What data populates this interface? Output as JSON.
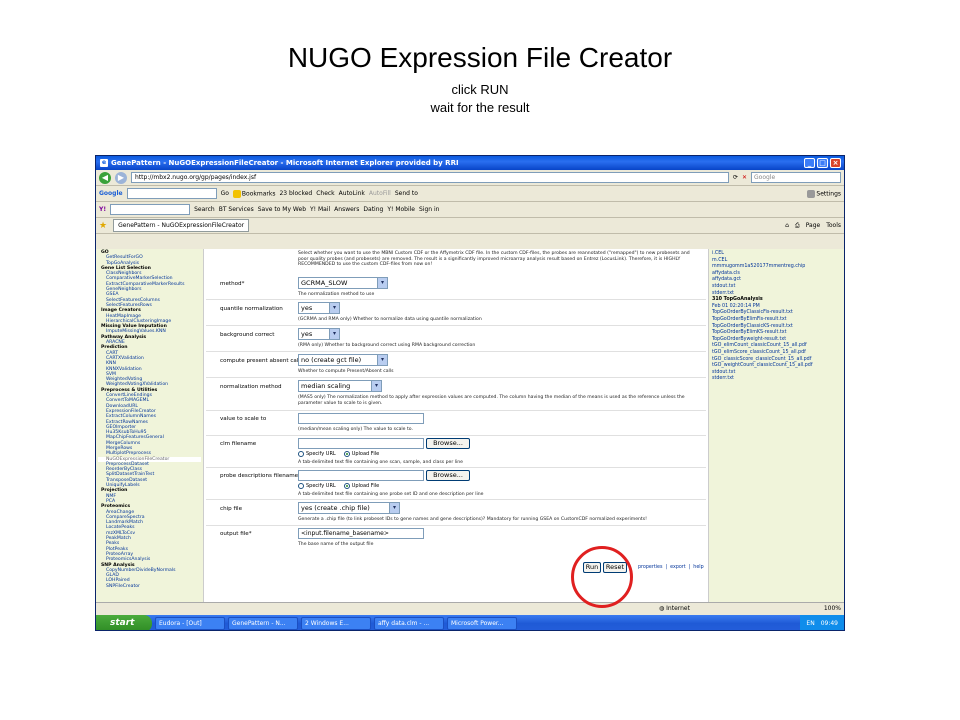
{
  "slide": {
    "title": "NUGO Expression File Creator",
    "subtitle1": "click RUN",
    "subtitle2": "wait for the result"
  },
  "browser": {
    "window_title": "GenePattern - NuGOExpressionFileCreator - Microsoft Internet Explorer provided by RRI",
    "address_label": "Address",
    "url": "http://mbx2.nugo.org/gp/pages/index.jsf",
    "search_placeholder": "Google",
    "google_bar": [
      "Google",
      "Go",
      "Bookmarks",
      "23 blocked",
      "Check",
      "AutoLink",
      "AutoFill",
      "Send to",
      "Settings"
    ],
    "yahoo_bar": [
      "Y!",
      "Search",
      "BT Services",
      "Save to My Web",
      "Y! Mail",
      "Answers",
      "Dating",
      "Y! Mobile",
      "Sign in"
    ],
    "tab_title": "GenePattern - NuGOExpressionFileCreator",
    "tab_tools": [
      "Page",
      "Tools"
    ]
  },
  "sidebar": {
    "items": [
      {
        "label": "GO",
        "type": "cat"
      },
      {
        "label": "GetResultForGO",
        "type": "item"
      },
      {
        "label": "TopGoAnalysis",
        "type": "item"
      },
      {
        "label": "Gene List Selection",
        "type": "cat"
      },
      {
        "label": "ClassNeighbors",
        "type": "item"
      },
      {
        "label": "ComparativeMarkerSelection",
        "type": "item"
      },
      {
        "label": "ExtractComparativeMarkerResults",
        "type": "item"
      },
      {
        "label": "GeneNeighbors",
        "type": "item"
      },
      {
        "label": "GSEA",
        "type": "item"
      },
      {
        "label": "SelectFeaturesColumns",
        "type": "item"
      },
      {
        "label": "SelectFeaturesRows",
        "type": "item"
      },
      {
        "label": "Image Creators",
        "type": "cat"
      },
      {
        "label": "HeatMapImage",
        "type": "item"
      },
      {
        "label": "HierarchicalClusteringImage",
        "type": "item"
      },
      {
        "label": "Missing Value Imputation",
        "type": "cat"
      },
      {
        "label": "ImputeMissingValues.KNN",
        "type": "item"
      },
      {
        "label": "Pathway Analysis",
        "type": "cat"
      },
      {
        "label": "ARACNE",
        "type": "item"
      },
      {
        "label": "Prediction",
        "type": "cat"
      },
      {
        "label": "CART",
        "type": "item"
      },
      {
        "label": "CARTXValidation",
        "type": "item"
      },
      {
        "label": "KNN",
        "type": "item"
      },
      {
        "label": "KNNXValidation",
        "type": "item"
      },
      {
        "label": "SVM",
        "type": "item"
      },
      {
        "label": "WeightedVoting",
        "type": "item"
      },
      {
        "label": "WeightedVotingXValidation",
        "type": "item"
      },
      {
        "label": "Preprocess & Utilities",
        "type": "cat"
      },
      {
        "label": "ConvertLineEndings",
        "type": "item"
      },
      {
        "label": "ConvertToMAGEML",
        "type": "item"
      },
      {
        "label": "DownloadURL",
        "type": "item"
      },
      {
        "label": "ExpressionFileCreator",
        "type": "item"
      },
      {
        "label": "ExtractColumnNames",
        "type": "item"
      },
      {
        "label": "ExtractRowNames",
        "type": "item"
      },
      {
        "label": "GEOImporter",
        "type": "item"
      },
      {
        "label": "Hu35KsubToHu95",
        "type": "item"
      },
      {
        "label": "MapChipFeaturesGeneral",
        "type": "item"
      },
      {
        "label": "MergeColumns",
        "type": "item"
      },
      {
        "label": "MergeRows",
        "type": "item"
      },
      {
        "label": "MultiplotPreprocess",
        "type": "item"
      },
      {
        "label": "NuGOExpressionFileCreator",
        "type": "sel"
      },
      {
        "label": "PreprocessDataset",
        "type": "item"
      },
      {
        "label": "ReorderByClass",
        "type": "item"
      },
      {
        "label": "SplitDatasetTrainTest",
        "type": "item"
      },
      {
        "label": "TransposeDataset",
        "type": "item"
      },
      {
        "label": "UniquifyLabels",
        "type": "item"
      },
      {
        "label": "Projection",
        "type": "cat"
      },
      {
        "label": "NMF",
        "type": "item"
      },
      {
        "label": "PCA",
        "type": "item"
      },
      {
        "label": "Proteomics",
        "type": "cat"
      },
      {
        "label": "AreaChange",
        "type": "item"
      },
      {
        "label": "CompareSpectra",
        "type": "item"
      },
      {
        "label": "LandmarkMatch",
        "type": "item"
      },
      {
        "label": "LocatePeaks",
        "type": "item"
      },
      {
        "label": "mzXMLToCsv",
        "type": "item"
      },
      {
        "label": "PeakMatch",
        "type": "item"
      },
      {
        "label": "Peaks",
        "type": "item"
      },
      {
        "label": "PlotPeaks",
        "type": "item"
      },
      {
        "label": "ProteoArray",
        "type": "item"
      },
      {
        "label": "ProteomicsAnalysis",
        "type": "item"
      },
      {
        "label": "SNP Analysis",
        "type": "cat"
      },
      {
        "label": "CopyNumberDivideByNormals",
        "type": "item"
      },
      {
        "label": "GLAD",
        "type": "item"
      },
      {
        "label": "LOHPaired",
        "type": "item"
      },
      {
        "label": "SNPFileCreator",
        "type": "item"
      }
    ]
  },
  "form": {
    "top_description": "Select whether you want to use the MBNI Custom CDF or the Affymetrix CDF file. In the custom CDF-files, the probes are reannotated (\"remapped\") to new probesets and poor quality probes (and probesets) are removed. The result is a significantly improved microarray analysis result based on Entrez (LocusLink). Therefore, it is HIGHLY RECOMMENDED to use the custom CDF-files from now on!",
    "method": {
      "label": "method*",
      "value": "GCRMA_SLOW",
      "desc": "The normalization method to use"
    },
    "quantile": {
      "label": "quantile normalization",
      "value": "yes",
      "desc": "(GCRMA and RMA only) Whether to normalize data using quantile normalization"
    },
    "background": {
      "label": "background correct",
      "value": "yes",
      "desc": "(RMA only) Whether to background correct using RMA background correction"
    },
    "present_absent": {
      "label": "compute present absent calls",
      "value": "no (create gct file)",
      "desc": "Whether to compute Present/Absent calls"
    },
    "norm_method": {
      "label": "normalization method",
      "value": "median scaling",
      "desc": "(MAS5 only) The normalization method to apply after expression values are computed. The column having the median of the means is used as the reference unless the parameter value to scale to is given."
    },
    "scale_to": {
      "label": "value to scale to",
      "value": "",
      "desc": "(median/mean scaling only) The value to scale to."
    },
    "clm": {
      "label": "clm filename",
      "browse": "Browse...",
      "specify_url": "Specify URL",
      "upload_file": "Upload File",
      "desc": "A tab-delimited text file containing one scan, sample, and class per line"
    },
    "probe_desc": {
      "label": "probe descriptions filename",
      "browse": "Browse...",
      "specify_url": "Specify URL",
      "upload_file": "Upload File",
      "desc": "A tab-delimited text file containing one probe set ID and one description per line"
    },
    "chip": {
      "label": "chip file",
      "value": "yes (create .chip file)",
      "desc": "Generate a .chip file (to link probeset IDs to gene names and gene descriptions)? Mandatory for running GSEA on CustomCDF normalized experiments!"
    },
    "output": {
      "label": "output file*",
      "value": "<input.filename_basename>",
      "desc": "The base name of the output file"
    },
    "run_label": "Run",
    "reset_label": "Reset",
    "links": [
      "properties",
      "export",
      "help"
    ]
  },
  "right_panel": {
    "lines": [
      {
        "text": "i.CEL",
        "type": "file"
      },
      {
        "text": "m.CEL",
        "type": "file"
      },
      {
        "text": "mmmugomm1a520177mmentreg.chip",
        "type": "file"
      },
      {
        "text": "affydata.cls",
        "type": "file"
      },
      {
        "text": "affydata.gct",
        "type": "file"
      },
      {
        "text": "stdout.txt",
        "type": "file"
      },
      {
        "text": "stderr.txt",
        "type": "file"
      },
      {
        "text": "310  TopGoAnalysis",
        "type": "job"
      },
      {
        "text": "Feb 01 02:20:14 PM",
        "type": "file"
      },
      {
        "text": "TopGoOrderByClassicFis-result.txt",
        "type": "file"
      },
      {
        "text": "TopGoOrderByElimFis-result.txt",
        "type": "file"
      },
      {
        "text": "TopGoOrderByClassicKS-result.txt",
        "type": "file"
      },
      {
        "text": "TopGoOrderByElimKS-result.txt",
        "type": "file"
      },
      {
        "text": "TopGoOrderByweight-result.txt",
        "type": "file"
      },
      {
        "text": "tGO_elimCount_classicCount_15_all.pdf",
        "type": "file"
      },
      {
        "text": "tGO_elimScore_classicCount_15_all.pdf",
        "type": "file"
      },
      {
        "text": "tGO_classicScore_classicCount_15_all.pdf",
        "type": "file"
      },
      {
        "text": "tGO_weightCount_classicCount_15_all.pdf",
        "type": "file"
      },
      {
        "text": "stdout.txt",
        "type": "file"
      },
      {
        "text": "stderr.txt",
        "type": "file"
      }
    ]
  },
  "statusbar": {
    "zone": "Internet",
    "zoom": "100%"
  },
  "taskbar": {
    "start": "start",
    "tasks": [
      "Eudora - [Out]",
      "GenePattern - N...",
      "2 Windows E...",
      "affy data.clm - ...",
      "Microsoft Power..."
    ],
    "lang": "EN",
    "clock": "09:49"
  },
  "colors": {
    "highlight_ring": "#e02020",
    "xp_blue": "#245edb",
    "panel_bg": "#f0f4da"
  }
}
